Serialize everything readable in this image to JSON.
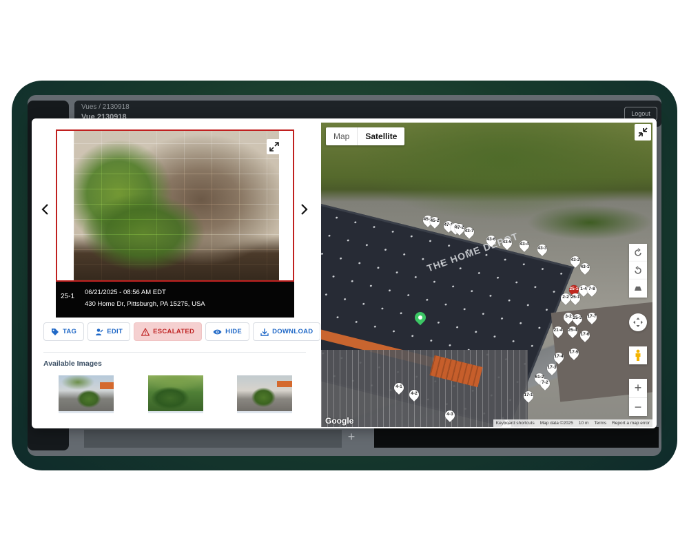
{
  "background": {
    "breadcrumb": "Vues  /  2130918",
    "title": "Vue 2130918",
    "logout_label": "Logout",
    "plus_label": "+"
  },
  "viewer": {
    "prev_icon": "chevron-left-icon",
    "next_icon": "chevron-right-icon",
    "expand_icon": "expand-icon",
    "caption": {
      "id": "25-1",
      "datetime": "06/21/2025 - 08:56 AM EDT",
      "address": "430 Home Dr, Pittsburgh, PA 15275, USA"
    },
    "status_border_color": "#c0201f"
  },
  "actions": [
    {
      "label": "TAG",
      "icon": "tag-icon"
    },
    {
      "label": "EDIT",
      "icon": "edit-user-icon"
    },
    {
      "label": "ESCALATED",
      "icon": "warning-icon",
      "color": "#c02626"
    },
    {
      "label": "HIDE",
      "icon": "eye-icon"
    },
    {
      "label": "DOWNLOAD",
      "icon": "download-icon"
    }
  ],
  "available_images": {
    "title": "Available Images",
    "count": 3
  },
  "map": {
    "tabs": [
      "Map",
      "Satellite"
    ],
    "active_tab": "Satellite",
    "store_logo_text": "THE HOME DEPOT",
    "pins": [
      "45-1",
      "45-2",
      "47-1",
      "4",
      "47-2",
      "43-7",
      "43-6",
      "43-5",
      "43-4",
      "43-3",
      "43-2",
      "43-1",
      "25-1",
      "1-4",
      "7-8",
      "2-2",
      "25-1",
      "3-2",
      "25-3",
      "17-7",
      "21-4",
      "25-4",
      "17-6",
      "17-5",
      "17-4",
      "17-3",
      "61-2",
      "7-2",
      "17-1",
      "4-1",
      "4-2",
      "4-3",
      "4-5"
    ],
    "selected_pin": "25-1",
    "zoom_in": "+",
    "zoom_out": "−",
    "google_label": "Google",
    "attribution": [
      "Keyboard shortcuts",
      "Map data ©2025",
      "10 m",
      "Terms",
      "Report a map error"
    ]
  }
}
